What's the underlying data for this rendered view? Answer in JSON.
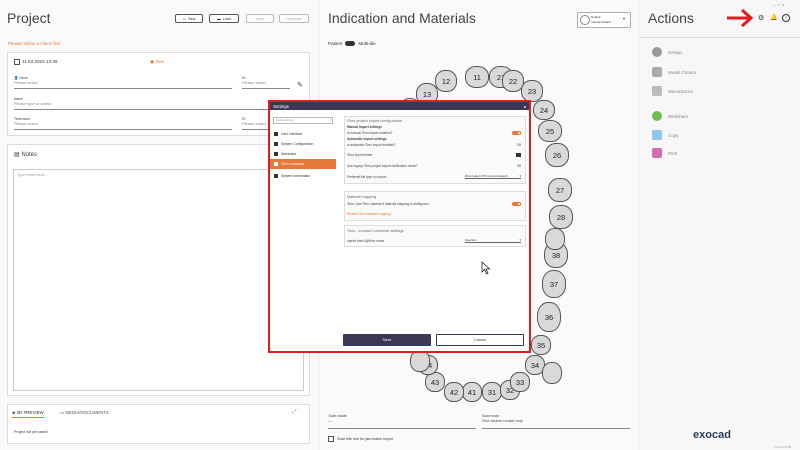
{
  "project": {
    "title": "Project",
    "buttons": {
      "new": "New",
      "load": "Load",
      "save": "Save",
      "duplicate": "Duplicate"
    },
    "warning": "Please select a client first.",
    "date": "11.03.2024 13:36",
    "due_label": "Due",
    "client_label": "Client",
    "client_placeholder": "Please select",
    "id_label": "ID",
    "id_placeholder": "Please select",
    "name_label": "Name",
    "name_placeholder": "Please type or select",
    "technician_label": "Technician",
    "technician_placeholder": "Please select",
    "tech_id_label": "ID",
    "tech_id_placeholder": "Please select",
    "notes_title": "Notes",
    "notes_placeholder": "Type notes here...",
    "tab_preview": "3D PREVIEW",
    "tab_media": "MEDIA/DOCUMENTS",
    "status": "Project not yet saved"
  },
  "indication": {
    "title": "Indication and Materials",
    "patient_label": "Patient",
    "multidie_label": "Multi-die",
    "default_line1": "Default",
    "default_line2": "manual default",
    "teeth_upper": [
      "11",
      "12",
      "13",
      "21",
      "22",
      "23",
      "24",
      "25",
      "26",
      "27",
      "28"
    ],
    "teeth_lower": [
      "31",
      "32",
      "33",
      "34",
      "35",
      "36",
      "37",
      "38",
      "41",
      "42",
      "43",
      "44"
    ],
    "tooth_shade_label": "Tooth shade",
    "tooth_shade_value": "—",
    "scan_mode_label": "Scan mode",
    "scan_mode_value": "One sleeve model only",
    "scan_bite_label": "Scan bite fork for jaw motion import"
  },
  "actions": {
    "title": "Actions",
    "items": [
      "Design",
      "Model Creator",
      "Manufacture",
      "Webshare",
      "Copy",
      "Print"
    ],
    "logo": "exocad",
    "version": "v3.2.0.11705"
  },
  "settings": {
    "title": "Settings",
    "search_placeholder": "Find settings",
    "nav": [
      "User Interface",
      "System Configuration",
      "Webshare",
      "iTero connector",
      "System Information"
    ],
    "section1_title": "iTero project import configuration",
    "manual_import_title": "Manual import settings",
    "manual_import_enabled": "Is manual iTero import enabled?",
    "auto_import_title": "Automatic import settings",
    "auto_import_enabled": "Is automatic iTero import enabled?",
    "auto_import_value": "Off",
    "import_folder": "iTero import folder",
    "ignore_label": "Use legacy iTero project export notification mode?",
    "ignore_value": "Off",
    "material_type_label": "Preferred file type for import",
    "material_type_value": "iTero folder (iTO.recommended)",
    "section2_title": "Material mapping",
    "material_mapping_label": "iTero: Use iTero material if material mapping is ambiguous",
    "material_link": "Review iTero material mapping",
    "section3_title": "iTero - exocad Connector settings",
    "connector_label": "Import from MyView mode",
    "connector_value": "Insertion",
    "save": "Save",
    "cancel": "Cancel"
  }
}
